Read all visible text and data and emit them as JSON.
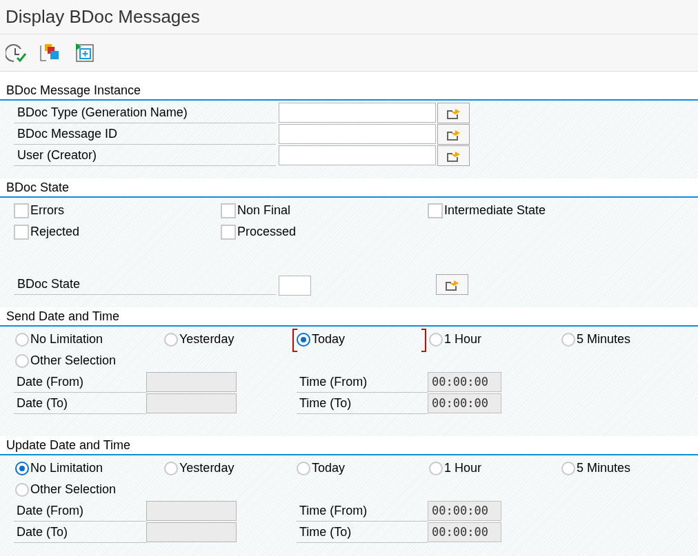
{
  "window": {
    "title": "Display BDoc Messages"
  },
  "toolbar": [
    {
      "kind": "clock-check"
    },
    {
      "kind": "squares"
    },
    {
      "kind": "add-frame"
    }
  ],
  "sections": [
    {
      "kind": "fields",
      "title": "BDoc Message Instance",
      "rows": [
        {
          "label": "BDoc Type (Generation Name)"
        },
        {
          "label": "BDoc Message ID"
        },
        {
          "label": "User (Creator)"
        }
      ]
    },
    {
      "kind": "checks",
      "title": "BDoc State",
      "checks": [
        {
          "label": "Errors",
          "checked": false
        },
        {
          "label": "Non Final",
          "checked": false
        },
        {
          "label": "Intermediate State",
          "checked": false
        },
        {
          "label": "Rejected",
          "checked": false
        },
        {
          "label": "Processed",
          "checked": false
        }
      ],
      "field": {
        "label": "BDoc State"
      }
    },
    {
      "kind": "datetime",
      "title": "Send Date and Time",
      "options": [
        {
          "label": "No Limitation",
          "selected": false,
          "focused": false
        },
        {
          "label": "Yesterday",
          "selected": false,
          "focused": false
        },
        {
          "label": "Today",
          "selected": true,
          "focused": true
        },
        {
          "label": "1 Hour",
          "selected": false,
          "focused": false
        },
        {
          "label": "5 Minutes",
          "selected": false,
          "focused": false
        },
        {
          "label": "Other Selection",
          "selected": false,
          "focused": false
        }
      ],
      "rows": [
        {
          "date_label": "Date (From)",
          "date_disabled": true,
          "time_label": "Time (From)",
          "time_value": "00:00:00"
        },
        {
          "date_label": "Date (To)",
          "date_disabled": true,
          "time_label": "Time (To)",
          "time_value": "00:00:00"
        }
      ]
    },
    {
      "kind": "datetime",
      "title": "Update Date and Time",
      "options": [
        {
          "label": "No Limitation",
          "selected": true,
          "focused": false
        },
        {
          "label": "Yesterday",
          "selected": false,
          "focused": false
        },
        {
          "label": "Today",
          "selected": false,
          "focused": false
        },
        {
          "label": "1 Hour",
          "selected": false,
          "focused": false
        },
        {
          "label": "5 Minutes",
          "selected": false,
          "focused": false
        },
        {
          "label": "Other Selection",
          "selected": false,
          "focused": false
        }
      ],
      "rows": [
        {
          "date_label": "Date (From)",
          "date_disabled": true,
          "time_label": "Time (From)",
          "time_value": "00:00:00"
        },
        {
          "date_label": "Date (To)",
          "date_disabled": true,
          "time_label": "Time (To)",
          "time_value": "00:00:00"
        }
      ]
    }
  ]
}
